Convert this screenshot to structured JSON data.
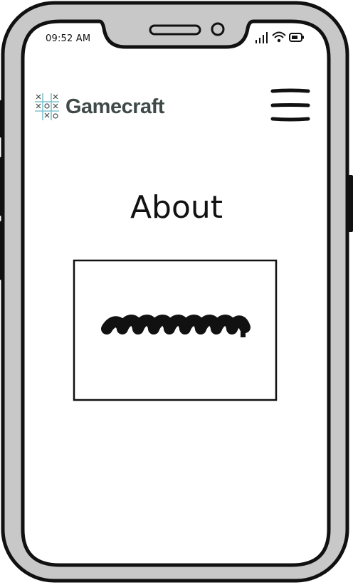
{
  "status_bar": {
    "time": "09:52 AM",
    "icons": [
      "signal-icon",
      "wifi-icon",
      "battery-icon"
    ]
  },
  "header": {
    "brand": "Gamecraft",
    "logo_icon": "tic-tac-toe-icon",
    "menu_icon": "hamburger-menu-icon"
  },
  "main": {
    "title": "About",
    "image_placeholder_icon": "scribble-image-placeholder"
  },
  "colors": {
    "frame": "#c8c8c8",
    "outline": "#111111",
    "brand_text": "#3f4a48",
    "logo_accent": "#7fc3cf"
  }
}
